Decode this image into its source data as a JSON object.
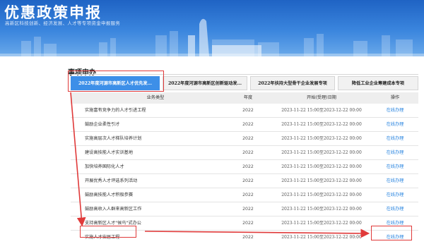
{
  "banner": {
    "title": "优惠政策申报",
    "subtitle": "高新区科技创新、经济发展、人才等专项资金申报服务"
  },
  "section": {
    "title": "事项申办"
  },
  "tabs": [
    {
      "label": "2022年度河源市高新区人才优先发...",
      "active": true
    },
    {
      "label": "2022年度河源市高新区创新驱动发...",
      "active": false
    },
    {
      "label": "2022年扶持大型骨干企业发展专项",
      "active": false
    },
    {
      "label": "降低工业企业筹建成本专项",
      "active": false
    }
  ],
  "table": {
    "headers": {
      "name": "业务类型",
      "year": "年度",
      "date": "开始(受理)日期",
      "op": "操作"
    },
    "rows": [
      {
        "name": "实施富有竞争力的人才引进工程",
        "year": "2022",
        "date": "2023-11-22 15:00至2023-12-22 00:00",
        "op": "在线办理"
      },
      {
        "name": "鼓励企业柔性引才",
        "year": "2022",
        "date": "2023-11-22 15:00至2023-12-22 00:00",
        "op": "在线办理"
      },
      {
        "name": "实施高层次人才梯队培养计划",
        "year": "2022",
        "date": "2023-11-22 15:00至2023-12-22 00:00",
        "op": "在线办理"
      },
      {
        "name": "建设高技能人才实训基地",
        "year": "2022",
        "date": "2023-11-22 15:00至2023-12-22 00:00",
        "op": "在线办理"
      },
      {
        "name": "加快培养国际化人才",
        "year": "2022",
        "date": "2023-11-22 15:00至2023-12-22 00:00",
        "op": "在线办理"
      },
      {
        "name": "开展优秀人才评选系列活动",
        "year": "2022",
        "date": "2023-11-22 15:00至2023-12-22 00:00",
        "op": "在线办理"
      },
      {
        "name": "鼓励高技能人才积极参赛",
        "year": "2022",
        "date": "2023-11-22 15:00至2023-12-22 00:00",
        "op": "在线办理"
      },
      {
        "name": "鼓励高收入人群来高新区工作",
        "year": "2022",
        "date": "2023-11-22 15:00至2023-12-22 00:00",
        "op": "在线办理"
      },
      {
        "name": "支持高新区人才\"候鸟\"式办公",
        "year": "2022",
        "date": "2023-11-22 15:00至2023-12-22 00:00",
        "op": "在线办理"
      },
      {
        "name": "实施人才安居工程",
        "year": "2022",
        "date": "2023-11-22 15:00至2023-12-22 00:00",
        "op": "在线办理"
      }
    ]
  },
  "colors": {
    "banner": "#2f78d6",
    "active_tab": "#3d8fe8",
    "link": "#2b86e0",
    "annotation": "#e03a3a"
  }
}
